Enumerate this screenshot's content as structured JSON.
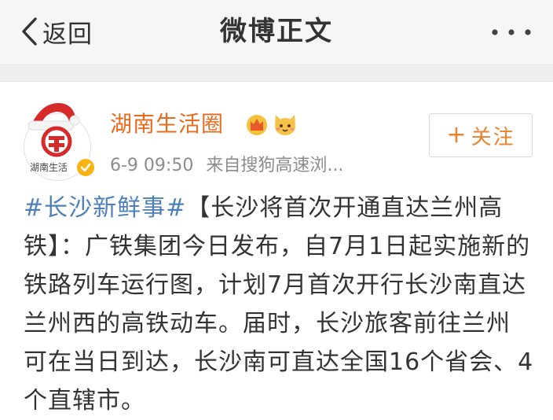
{
  "nav": {
    "back_label": "返回",
    "title": "微博正文",
    "more_icon": "more-dots-icon"
  },
  "post": {
    "user_name": "湖南生活圈",
    "avatar_text": "湖南生活",
    "timestamp": "6-9 09:50",
    "source": "来自搜狗高速浏...",
    "follow_plus": "+",
    "follow_label": "关注",
    "topic": "#长沙新鲜事#",
    "body": "【长沙将首次开通直达兰州高铁】：广铁集团今日发布，自7月1日起实施新的铁路列车运行图，计划7月首次开行长沙南直达兰州西的高铁动车。届时，长沙旅客前往兰州可在当日到达，长沙南可直达全国16个省会、4个直辖市。"
  },
  "colors": {
    "nav_bg": "#f6f6f6",
    "user_name": "#e86c1e",
    "topic_link": "#4d7fb8",
    "follow_accent": "#e8832e",
    "meta_text": "#8c8c8c",
    "body_text": "#333333"
  }
}
